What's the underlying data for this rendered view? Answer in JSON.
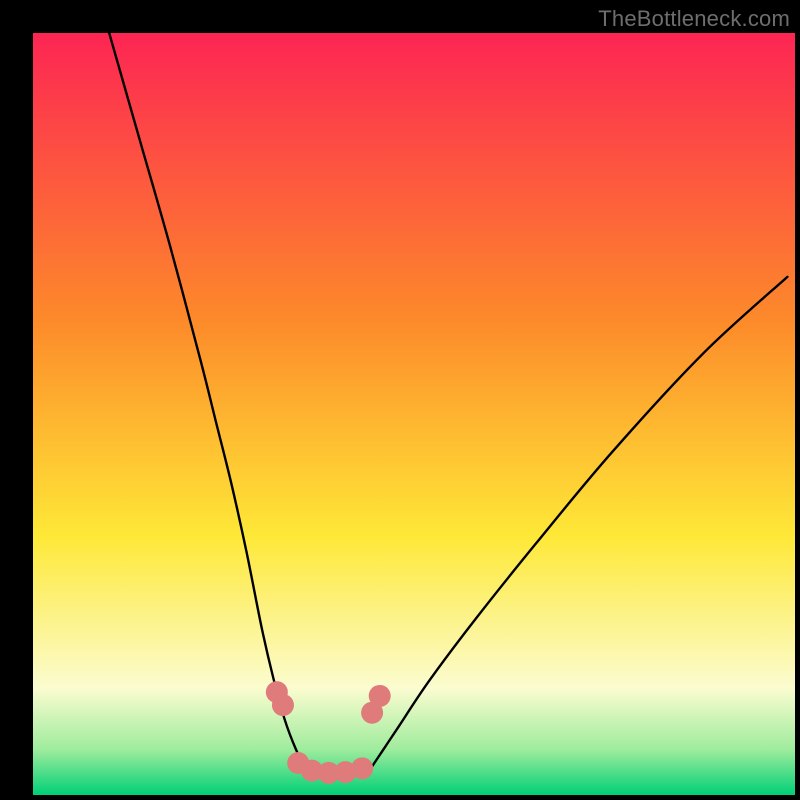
{
  "watermark": "TheBottleneck.com",
  "chart_data": {
    "type": "line",
    "title": "",
    "xlabel": "",
    "ylabel": "",
    "xlim": [
      0,
      100
    ],
    "ylim": [
      0,
      100
    ],
    "grid": false,
    "legend": false,
    "annotations": [],
    "series": [
      {
        "name": "left-curve",
        "x": [
          10,
          14,
          18,
          22,
          24,
          26,
          28,
          30,
          31.5,
          33,
          34.5,
          36
        ],
        "values": [
          100,
          86,
          72,
          57,
          49,
          41,
          32,
          22,
          15.5,
          10,
          6,
          3
        ]
      },
      {
        "name": "right-curve",
        "x": [
          44,
          46,
          48,
          52,
          58,
          66,
          76,
          88,
          99
        ],
        "values": [
          3,
          6,
          9,
          15,
          23,
          33,
          45,
          58,
          68
        ]
      },
      {
        "name": "bottom-band-top",
        "x": [
          0,
          100
        ],
        "values": [
          11,
          11
        ]
      },
      {
        "name": "bottom-band-bottom",
        "x": [
          0,
          100
        ],
        "values": [
          0,
          0
        ]
      }
    ],
    "markers": [
      {
        "name": "left-marker-1",
        "x": 32.0,
        "y": 13.5
      },
      {
        "name": "left-marker-2",
        "x": 32.8,
        "y": 11.8
      },
      {
        "name": "right-marker-1",
        "x": 44.5,
        "y": 10.8
      },
      {
        "name": "right-marker-2",
        "x": 45.5,
        "y": 13.0
      },
      {
        "name": "basin-1",
        "x": 34.8,
        "y": 4.2
      },
      {
        "name": "basin-2",
        "x": 36.6,
        "y": 3.2
      },
      {
        "name": "basin-3",
        "x": 38.8,
        "y": 2.9
      },
      {
        "name": "basin-4",
        "x": 41.0,
        "y": 3.0
      },
      {
        "name": "basin-5",
        "x": 43.2,
        "y": 3.5
      }
    ],
    "colors": {
      "curve": "#000000",
      "marker": "#e07b7b",
      "gradient_top": "#fd2553",
      "gradient_mid1": "#fd8b2a",
      "gradient_mid2": "#fee837",
      "gradient_mid3": "#fbfcd0",
      "gradient_bot1": "#9fec9d",
      "gradient_bot2": "#00d076"
    }
  }
}
